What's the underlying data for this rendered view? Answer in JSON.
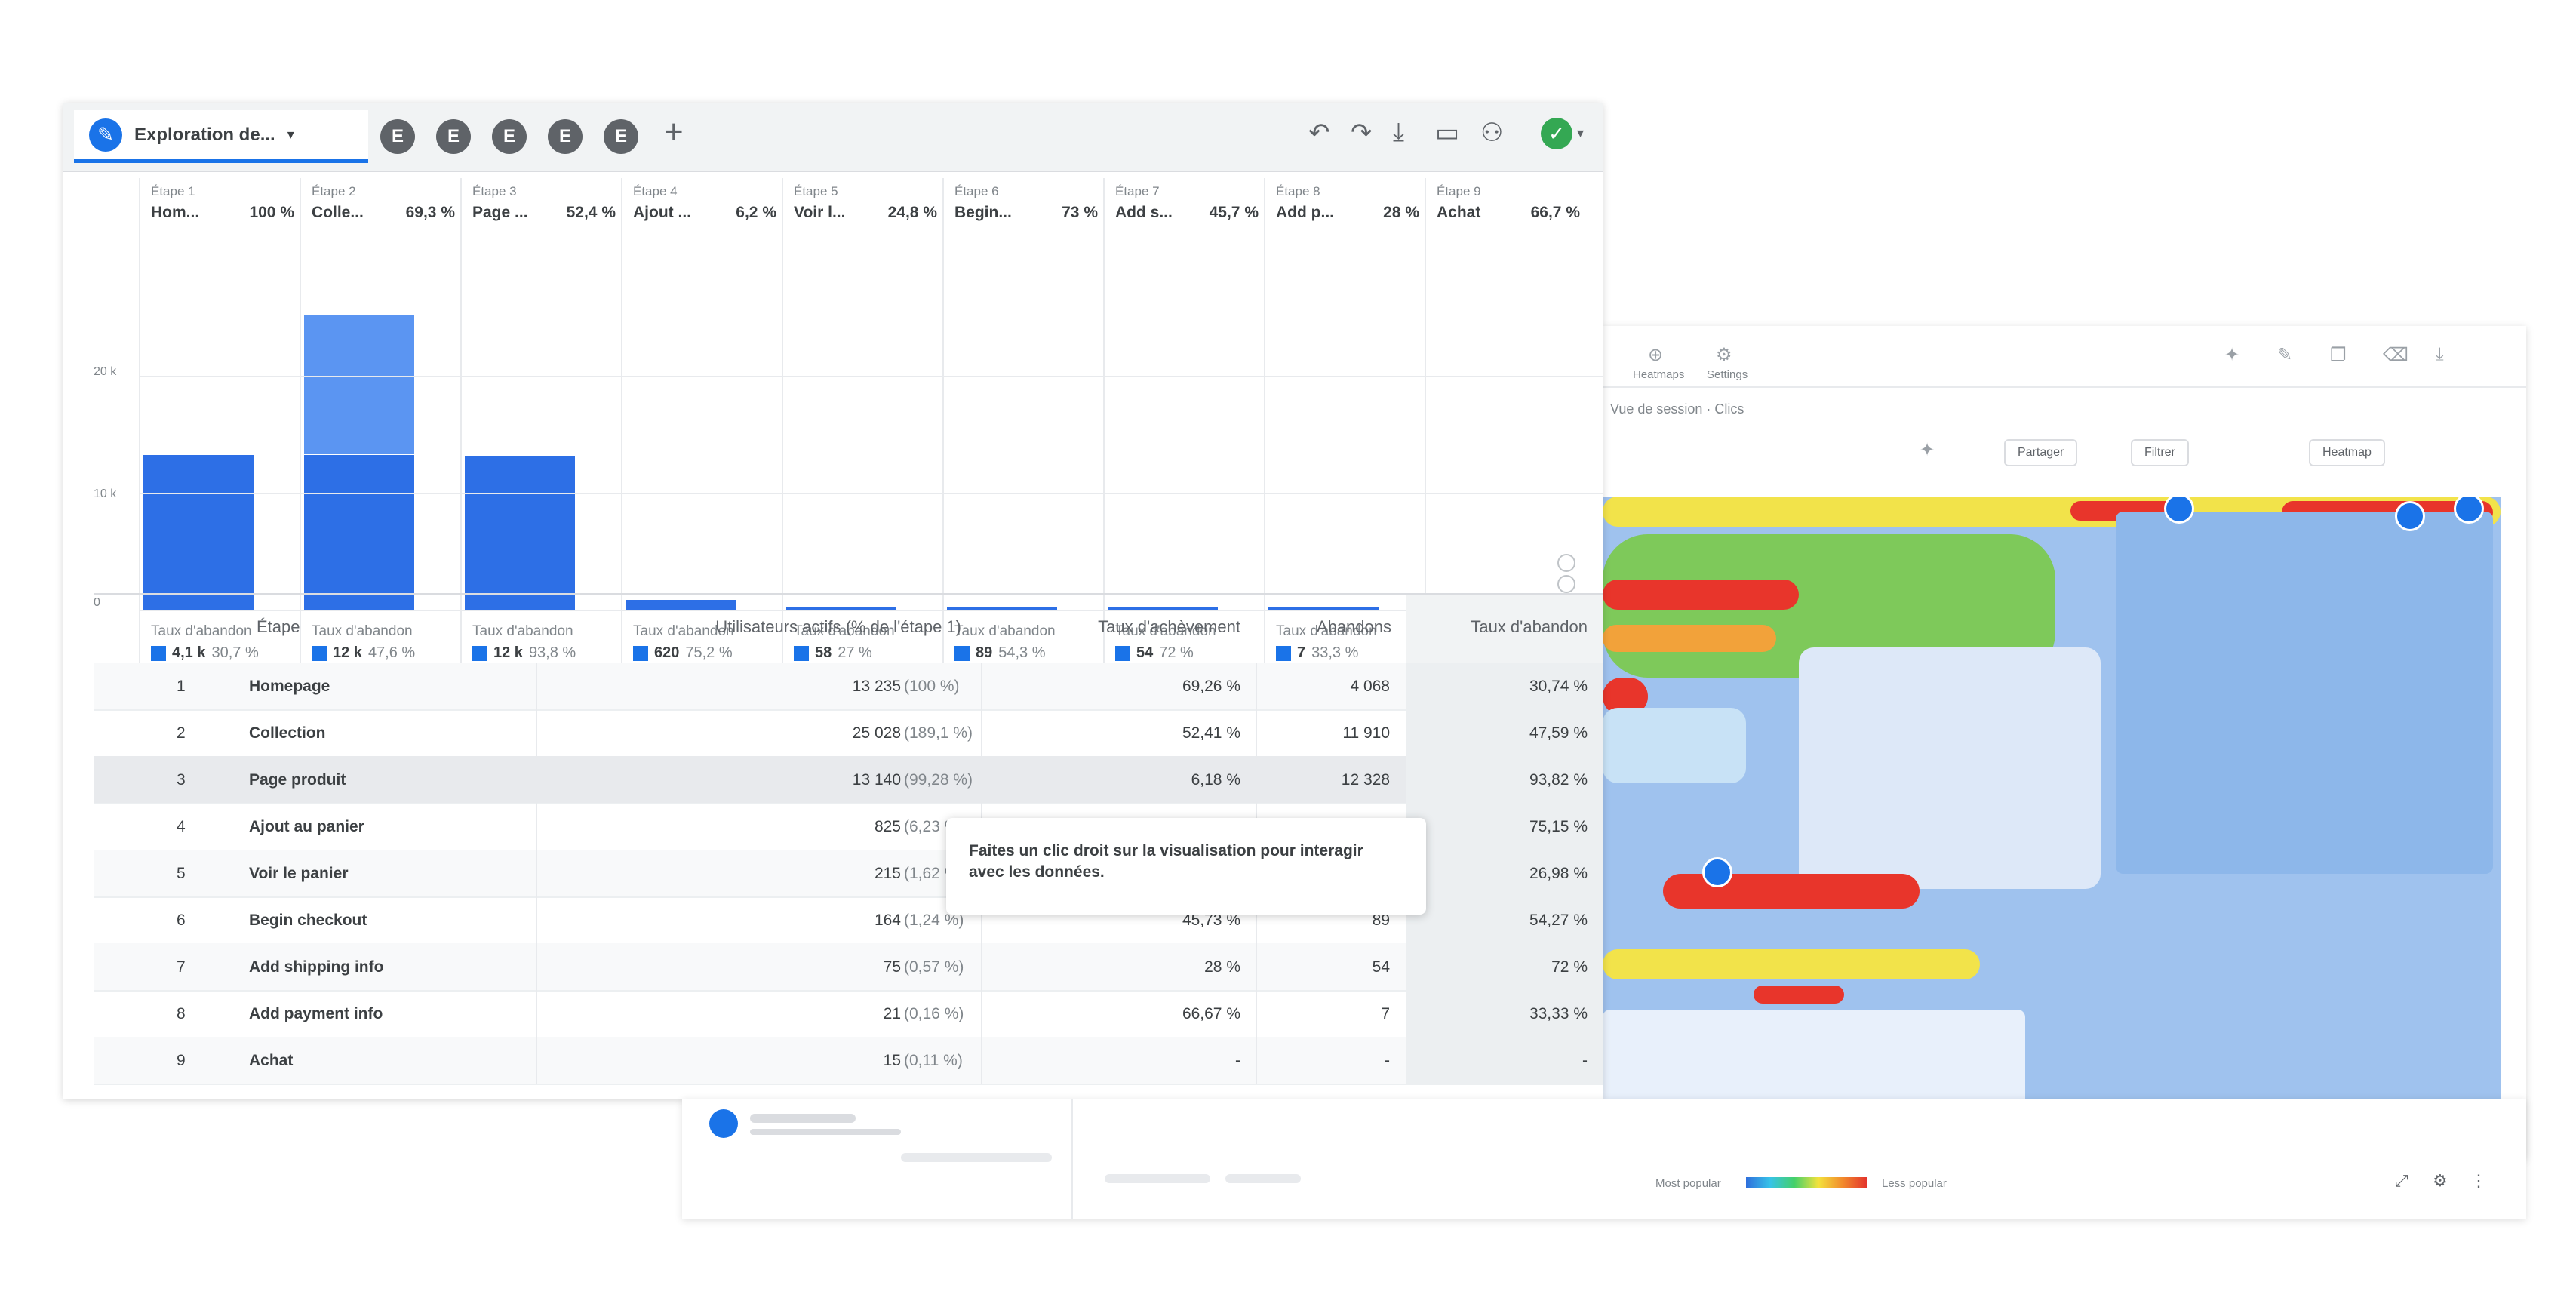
{
  "toolbar": {
    "title": "Exploration de...",
    "tabs": [
      "E",
      "E",
      "E",
      "E",
      "E"
    ],
    "add_label": "+",
    "icons": [
      "undo-icon",
      "redo-icon",
      "download-icon",
      "folder-icon",
      "share-user-icon",
      "check-circle-icon"
    ]
  },
  "funnel": {
    "y_ticks": [
      "20 k",
      "10 k",
      "0"
    ],
    "steps": [
      {
        "label": "Étape 1",
        "name": "Hom...",
        "pct": "100 %",
        "aband_label": "Taux d'abandon",
        "aband_num": "4,1 k",
        "aband_pct": "30,7 %"
      },
      {
        "label": "Étape 2",
        "name": "Colle...",
        "pct": "69,3 %",
        "aband_label": "Taux d'abandon",
        "aband_num": "12 k",
        "aband_pct": "47,6 %"
      },
      {
        "label": "Étape 3",
        "name": "Page ...",
        "pct": "52,4 %",
        "aband_label": "Taux d'abandon",
        "aband_num": "12 k",
        "aband_pct": "93,8 %"
      },
      {
        "label": "Étape 4",
        "name": "Ajout ...",
        "pct": "6,2 %",
        "aband_label": "Taux d'abandon",
        "aband_num": "620",
        "aband_pct": "75,2 %"
      },
      {
        "label": "Étape 5",
        "name": "Voir l...",
        "pct": "24,8 %",
        "aband_label": "Taux d'abandon",
        "aband_num": "58",
        "aband_pct": "27 %"
      },
      {
        "label": "Étape 6",
        "name": "Begin...",
        "pct": "73 %",
        "aband_label": "Taux d'abandon",
        "aband_num": "89",
        "aband_pct": "54,3 %"
      },
      {
        "label": "Étape 7",
        "name": "Add s...",
        "pct": "45,7 %",
        "aband_label": "Taux d'abandon",
        "aband_num": "54",
        "aband_pct": "72 %"
      },
      {
        "label": "Étape 8",
        "name": "Add p...",
        "pct": "28 %",
        "aband_label": "Taux d'abandon",
        "aband_num": "7",
        "aband_pct": "33,3 %"
      },
      {
        "label": "Étape 9",
        "name": "Achat",
        "pct": "66,7 %"
      }
    ]
  },
  "table": {
    "headers": [
      "Étape",
      "Utilisateurs actifs (% de l'étape 1)",
      "Taux d'achèvement",
      "Abandons",
      "Taux d'abandon"
    ],
    "rows": [
      {
        "n": "1",
        "step": "Homepage",
        "users": "13 235",
        "users_pct": "(100 %)",
        "rate": "69,26 %",
        "aband": "4 068",
        "aband_rate": "30,74 %"
      },
      {
        "n": "2",
        "step": "Collection",
        "users": "25 028",
        "users_pct": "(189,1 %)",
        "rate": "52,41 %",
        "aband": "11 910",
        "aband_rate": "47,59 %"
      },
      {
        "n": "3",
        "step": "Page produit",
        "users": "13 140",
        "users_pct": "(99,28 %)",
        "rate": "6,18 %",
        "aband": "12 328",
        "aband_rate": "93,82 %"
      },
      {
        "n": "4",
        "step": "Ajout au panier",
        "users": "825",
        "users_pct": "(6,23 %)",
        "rate": "",
        "aband": "",
        "aband_rate": "75,15 %"
      },
      {
        "n": "5",
        "step": "Voir le panier",
        "users": "215",
        "users_pct": "(1,62 %)",
        "rate": "",
        "aband": "",
        "aband_rate": "26,98 %"
      },
      {
        "n": "6",
        "step": "Begin checkout",
        "users": "164",
        "users_pct": "(1,24 %)",
        "rate": "45,73 %",
        "aband": "89",
        "aband_rate": "54,27 %"
      },
      {
        "n": "7",
        "step": "Add shipping info",
        "users": "75",
        "users_pct": "(0,57 %)",
        "rate": "28 %",
        "aband": "54",
        "aband_rate": "72 %"
      },
      {
        "n": "8",
        "step": "Add payment info",
        "users": "21",
        "users_pct": "(0,16 %)",
        "rate": "66,67 %",
        "aband": "7",
        "aband_rate": "33,33 %"
      },
      {
        "n": "9",
        "step": "Achat",
        "users": "15",
        "users_pct": "(0,11 %)",
        "rate": "-",
        "aband": "-",
        "aband_rate": "-"
      }
    ]
  },
  "tooltip": {
    "line1": "Faites un clic droit sur la visualisation pour interagir",
    "line2": "avec les données."
  },
  "heatmap": {
    "top_labels": [
      "Heatmaps",
      "Settings"
    ],
    "subbar": "Vue de session · Clics",
    "buttons": [
      "Partager",
      "Filtrer",
      "Heatmap"
    ],
    "icons": [
      "pin-icon",
      "pen-icon",
      "copy-icon",
      "trash-icon",
      "download-icon"
    ]
  },
  "bottom": {
    "legend": "Most popular",
    "legend_end": "Less popular"
  },
  "colors": {
    "bar_light": "#5b95f2",
    "bar_dark": "#2d6fe6",
    "accent": "#1a73e8"
  },
  "chart_data": {
    "type": "bar",
    "categories": [
      "Étape 1",
      "Étape 2",
      "Étape 3",
      "Étape 4",
      "Étape 5",
      "Étape 6",
      "Étape 7",
      "Étape 8",
      "Étape 9"
    ],
    "series": [
      {
        "values": [
          13235,
          13235,
          13140,
          825,
          215,
          164,
          75,
          21,
          15
        ]
      },
      {
        "values": [
          0,
          11793,
          0,
          0,
          0,
          0,
          0,
          0,
          0
        ]
      }
    ],
    "ylim": [
      0,
      20000
    ]
  }
}
